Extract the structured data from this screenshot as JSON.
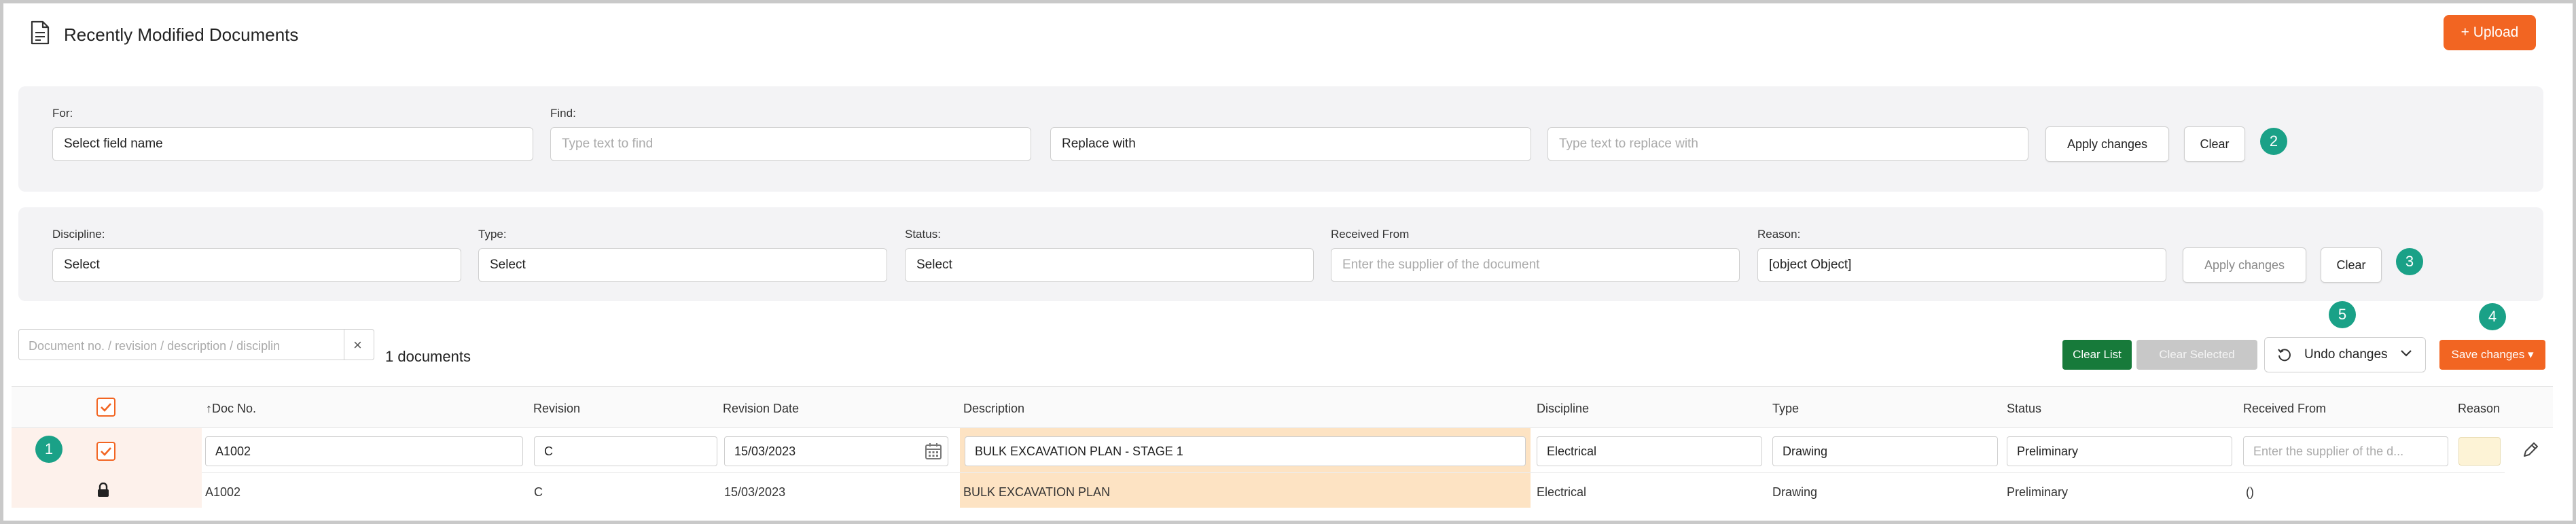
{
  "header": {
    "title": "Recently Modified Documents",
    "upload_label": "+ Upload",
    "colors": {
      "accent": "#f26522",
      "teal": "#1aa187",
      "green": "#177a3a"
    }
  },
  "replace_panel": {
    "for_label": "For:",
    "for_value": "Select field name",
    "find_label": "Find:",
    "find_placeholder": "Type text to find",
    "replace_value": "Replace with",
    "replace_placeholder": "Type text to replace with",
    "apply_label": "Apply changes",
    "clear_label": "Clear",
    "step": "2"
  },
  "bulk_panel": {
    "discipline_label": "Discipline:",
    "discipline_value": "Select",
    "type_label": "Type:",
    "type_value": "Select",
    "status_label": "Status:",
    "status_value": "Select",
    "received_label": "Received From",
    "received_placeholder": "Enter the supplier of the document",
    "reason_label": "Reason:",
    "reason_value": "[object Object]",
    "apply_label": "Apply changes",
    "clear_label": "Clear",
    "step": "3"
  },
  "toolbar": {
    "search_placeholder": "Document no. / revision / description / disciplin",
    "clear_x": "×",
    "doc_count": "1 documents",
    "clear_list_label": "Clear List",
    "clear_selected_label": "Clear Selected",
    "undo_label": "Undo changes",
    "save_label": "Save changes ▾",
    "undo_step": "5",
    "save_step": "4"
  },
  "table": {
    "columns": {
      "doc_no": "↑Doc No.",
      "revision": "Revision",
      "revision_date": "Revision Date",
      "description": "Description",
      "discipline": "Discipline",
      "type": "Type",
      "status": "Status",
      "received_from": "Received From",
      "reason": "Reason"
    },
    "row": {
      "step": "1",
      "edit": {
        "doc_no": "A1002",
        "revision": "C",
        "revision_date": "15/03/2023",
        "description": "BULK EXCAVATION PLAN - STAGE 1",
        "discipline": "Electrical",
        "type": "Drawing",
        "status": "Preliminary",
        "received_placeholder": "Enter the supplier of the d..."
      },
      "original": {
        "doc_no": "A1002",
        "revision": "C",
        "revision_date": "15/03/2023",
        "description": "BULK EXCAVATION PLAN",
        "discipline": "Electrical",
        "type": "Drawing",
        "status": "Preliminary",
        "received_from": "()"
      }
    }
  }
}
